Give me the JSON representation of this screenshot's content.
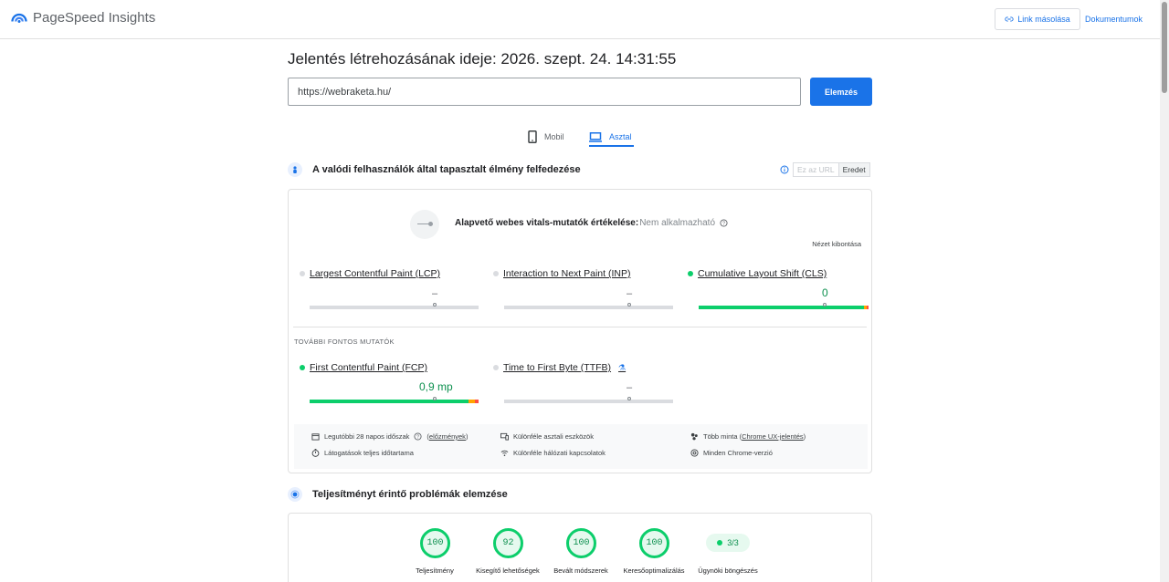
{
  "app": {
    "title": "PageSpeed Insights",
    "copy_link": "Link másolása",
    "docs": "Dokumentumok"
  },
  "report": {
    "title": "Jelentés létrehozásának ideje: 2026. szept. 24. 14:31:55",
    "url": "https://webraketa.hu/",
    "analyze": "Elemzés"
  },
  "tabs": {
    "mobile": "Mobil",
    "desktop": "Asztal",
    "active": "desktop"
  },
  "crux": {
    "heading": "A valódi felhasználók által tapasztalt élmény felfedezése",
    "toggle_url": "Ez az URL",
    "toggle_origin": "Eredet",
    "assessment_label": "Alapvető webes vitals-mutatók értékelése:",
    "assessment_status": "Nem alkalmazható",
    "expand_view": "Nézet kibontása",
    "metrics": [
      {
        "name": "Largest Contentful Paint (LCP)",
        "value": "–",
        "status": "none",
        "marker": 0.74
      },
      {
        "name": "Interaction to Next Paint (INP)",
        "value": "–",
        "status": "none",
        "marker": 0.74
      },
      {
        "name": "Cumulative Layout Shift (CLS)",
        "value": "0",
        "status": "good",
        "marker": 0.74
      }
    ],
    "further_label": "TOVÁBBI FONTOS MUTATÓK",
    "further_metrics": [
      {
        "name": "First Contentful Paint (FCP)",
        "value": "0,9 mp",
        "status": "good",
        "marker": 0.74
      },
      {
        "name": "Time to First Byte (TTFB)",
        "value": "–",
        "status": "none",
        "marker": 0.74,
        "flask": "⚗"
      }
    ],
    "meta": {
      "period": "Legutóbbi 28 napos időszak",
      "history": "előzmények",
      "devices": "Különféle asztali eszközök",
      "samples_prefix": "Több minta (",
      "samples_link": "Chrome UX-jelentés",
      "samples_suffix": ")",
      "duration": "Látogatások teljes időtartama",
      "network": "Különféle hálózati kapcsolatok",
      "chrome": "Minden Chrome-verzió"
    },
    "colors": {
      "good": "#0cce6b",
      "average": "#ffa400",
      "poor": "#ff4e42",
      "none": "#dadce0"
    }
  },
  "diagnosis": {
    "heading": "Teljesítményt érintő problémák elemzése",
    "scores": [
      {
        "label": "Teljesítmény",
        "value": "100"
      },
      {
        "label": "Kisegítő lehetőségek",
        "value": "92"
      },
      {
        "label": "Bevált módszerek",
        "value": "100"
      },
      {
        "label": "Keresőoptimalizálás",
        "value": "100"
      }
    ],
    "agent": {
      "label": "Ügynöki böngészés",
      "value": "3/3"
    }
  }
}
